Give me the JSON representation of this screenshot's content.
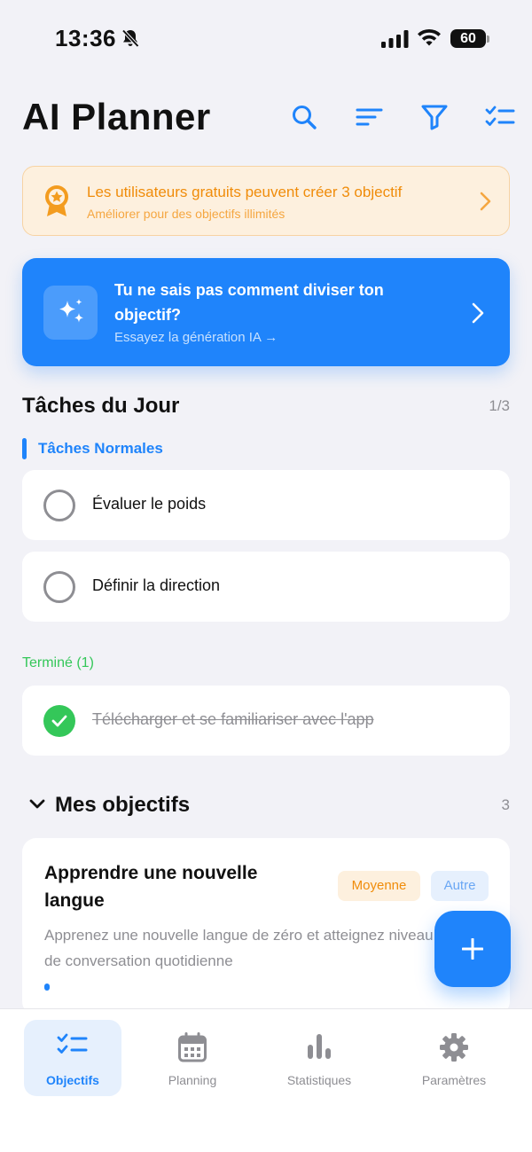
{
  "status_bar": {
    "time": "13:36",
    "battery": "60"
  },
  "header": {
    "title": "AI Planner"
  },
  "promo": {
    "title": "Les utilisateurs gratuits peuvent créer 3 objectif",
    "subtitle": "Améliorer pour des objectifs illimités"
  },
  "ai_card": {
    "title": "Tu ne sais pas comment diviser ton objectif?",
    "subtitle": "Essayez la génération IA →"
  },
  "today": {
    "title": "Tâches du Jour",
    "count": "1/3",
    "normal_label": "Tâches Normales",
    "tasks": [
      {
        "text": "Évaluer le poids"
      },
      {
        "text": "Définir la direction"
      }
    ],
    "done_label": "Terminé (1)",
    "done_tasks": [
      {
        "text": "Télécharger et se familiariser avec l'app"
      }
    ]
  },
  "objectives": {
    "title": "Mes objectifs",
    "count": "3",
    "items": [
      {
        "title": "Apprendre une nouvelle langue",
        "priority": "Moyenne",
        "category": "Autre",
        "description": "Apprenez une nouvelle langue de zéro et atteignez niveau de conversation quotidienne",
        "progress_percent": 1
      }
    ]
  },
  "tabs": [
    {
      "label": "Objectifs",
      "icon": "checklist-icon",
      "active": true
    },
    {
      "label": "Planning",
      "icon": "calendar-icon",
      "active": false
    },
    {
      "label": "Statistiques",
      "icon": "bar-chart-icon",
      "active": false
    },
    {
      "label": "Paramètres",
      "icon": "gear-icon",
      "active": false
    }
  ],
  "colors": {
    "accent": "#1f84fb",
    "success": "#34c759",
    "warning": "#f08c0a",
    "background": "#f2f2f7"
  }
}
